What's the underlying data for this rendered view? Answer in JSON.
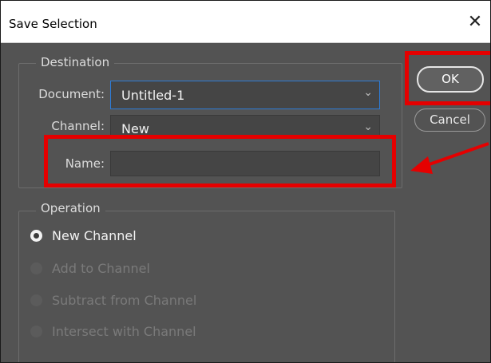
{
  "window": {
    "title": "Save Selection",
    "close_glyph": "✕"
  },
  "destination": {
    "legend": "Destination",
    "document_label": "Document:",
    "document_value": "Untitled-1",
    "channel_label": "Channel:",
    "channel_value": "New",
    "name_label": "Name:",
    "name_value": ""
  },
  "buttons": {
    "ok_label": "OK",
    "cancel_label": "Cancel"
  },
  "operation": {
    "legend": "Operation",
    "options": [
      {
        "label": "New Channel",
        "selected": true,
        "enabled": true
      },
      {
        "label": "Add to Channel",
        "selected": false,
        "enabled": false
      },
      {
        "label": "Subtract from Channel",
        "selected": false,
        "enabled": false
      },
      {
        "label": "Intersect with Channel",
        "selected": false,
        "enabled": false
      }
    ]
  },
  "annotations": {
    "color": "#e50000",
    "highlighted": [
      "OK button",
      "Name field"
    ]
  },
  "icons": {
    "close": "close-icon",
    "dropdown": "chevron-down-icon",
    "arrow": "arrow-icon"
  }
}
